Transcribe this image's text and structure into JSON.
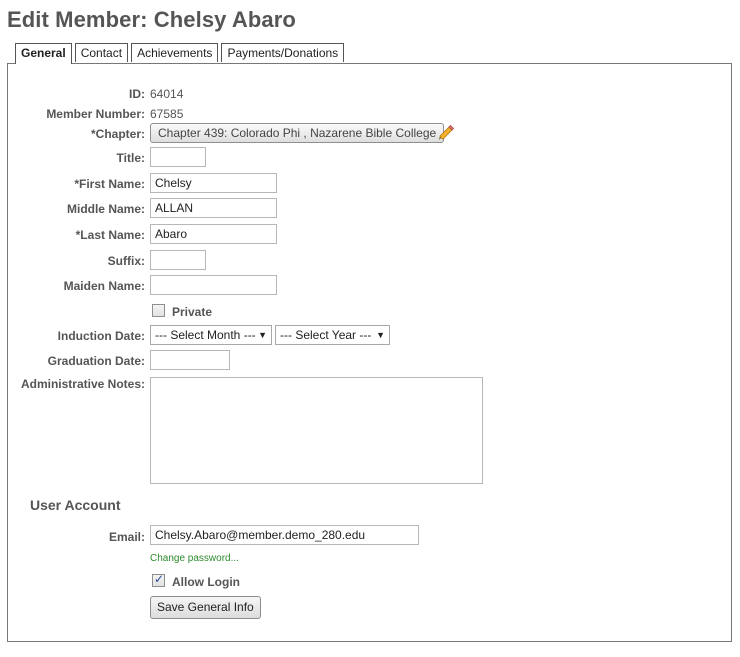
{
  "page": {
    "title": "Edit Member: Chelsy Abaro"
  },
  "tabs": [
    {
      "label": "General",
      "active": true
    },
    {
      "label": "Contact"
    },
    {
      "label": "Achievements"
    },
    {
      "label": "Payments/Donations"
    }
  ],
  "form": {
    "id_label": "ID:",
    "id_value": "64014",
    "member_number_label": "Member Number:",
    "member_number_value": "67585",
    "chapter_label": "*Chapter:",
    "chapter_value": "Chapter 439: Colorado Phi , Nazarene Bible College",
    "title_label": "Title:",
    "title_value": "",
    "first_name_label": "*First Name:",
    "first_name_value": "Chelsy",
    "middle_name_label": "Middle Name:",
    "middle_name_value": "ALLAN",
    "last_name_label": "*Last Name:",
    "last_name_value": "Abaro",
    "suffix_label": "Suffix:",
    "suffix_value": "",
    "maiden_name_label": "Maiden Name:",
    "maiden_name_value": "",
    "private_label": "Private",
    "private_checked": false,
    "induction_date_label": "Induction Date:",
    "induction_month": "--- Select Month ---",
    "induction_year": "--- Select Year ---",
    "graduation_date_label": "Graduation Date:",
    "graduation_date_value": "",
    "admin_notes_label": "Administrative Notes:",
    "admin_notes_value": ""
  },
  "user_account": {
    "heading": "User Account",
    "email_label": "Email:",
    "email_value": "Chelsy.Abaro@member.demo_280.edu",
    "change_password_link": "Change password...",
    "allow_login_label": "Allow Login",
    "allow_login_checked": true,
    "save_button": "Save General Info"
  },
  "colors": {
    "link": "#2e8b2e",
    "label": "#555555",
    "border": "#777777"
  }
}
